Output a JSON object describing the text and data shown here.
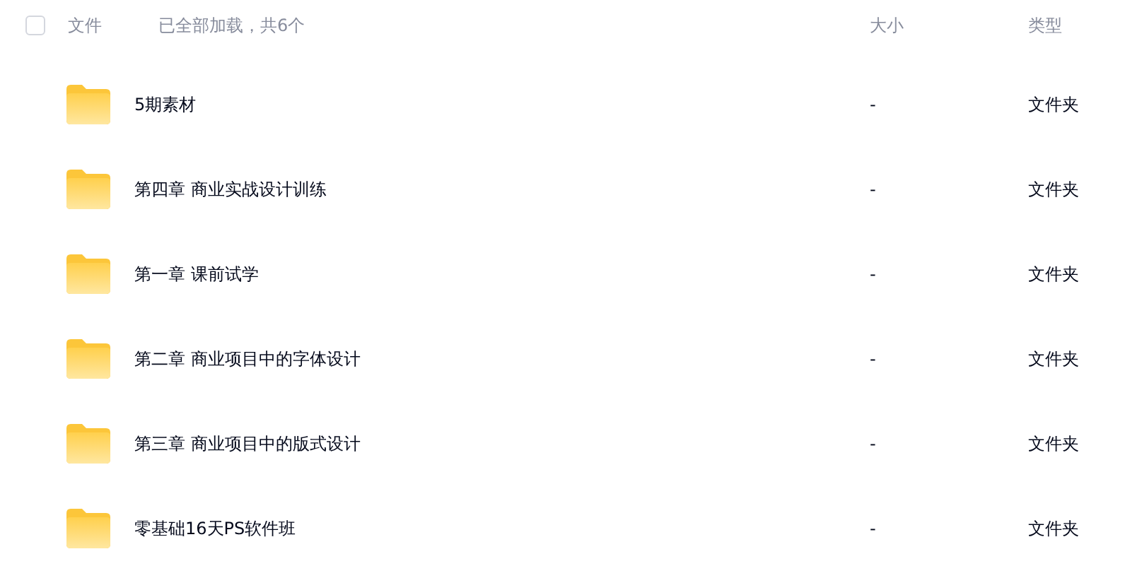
{
  "header": {
    "select_all": {
      "checked": false
    },
    "name_label": "文件",
    "status": "已全部加载，共6个",
    "size_label": "大小",
    "type_label": "类型"
  },
  "files": [
    {
      "name": "5期素材",
      "size": "-",
      "type": "文件夹"
    },
    {
      "name": "第四章 商业实战设计训练",
      "size": "-",
      "type": "文件夹"
    },
    {
      "name": "第一章 课前试学",
      "size": "-",
      "type": "文件夹"
    },
    {
      "name": "第二章 商业项目中的字体设计",
      "size": "-",
      "type": "文件夹"
    },
    {
      "name": "第三章 商业项目中的版式设计",
      "size": "-",
      "type": "文件夹"
    },
    {
      "name": "零基础16天PS软件班",
      "size": "-",
      "type": "文件夹"
    }
  ]
}
